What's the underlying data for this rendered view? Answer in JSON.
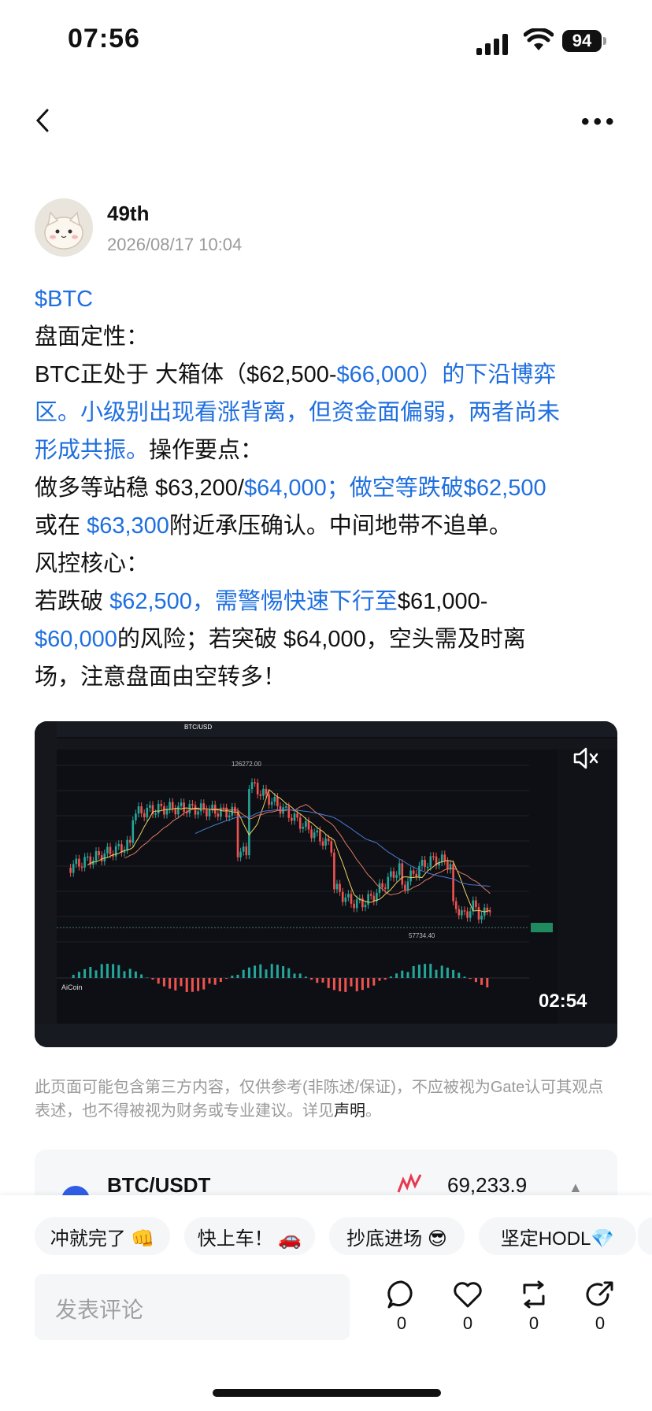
{
  "status_bar": {
    "time": "07:56",
    "battery": "94"
  },
  "author": {
    "name": "49th",
    "timestamp": "2026/08/17 10:04"
  },
  "post": {
    "lines": [
      [
        {
          "t": "$BTC",
          "c": "blue"
        }
      ],
      [
        {
          "t": "盘面定性：",
          "c": "black"
        }
      ],
      [
        {
          "t": "BTC正处于 大箱体（$62,500-",
          "c": "black"
        },
        {
          "t": "$66,000）的下沿博弈",
          "c": "blue"
        }
      ],
      [
        {
          "t": "区。小级别出现看涨背离，但资金面偏弱，两者尚未",
          "c": "blue"
        }
      ],
      [
        {
          "t": "形成共振。",
          "c": "blue"
        },
        {
          "t": "操作要点：",
          "c": "black"
        }
      ],
      [
        {
          "t": "做多等站稳 $63,200/",
          "c": "black"
        },
        {
          "t": "$64,000；做空等跌破$62,500",
          "c": "blue"
        }
      ],
      [
        {
          "t": "或在 ",
          "c": "black"
        },
        {
          "t": "$63,300",
          "c": "blue"
        },
        {
          "t": "附近承压确认。中间地带不追单。",
          "c": "black"
        }
      ],
      [
        {
          "t": "风控核心：",
          "c": "black"
        }
      ],
      [
        {
          "t": "若跌破 ",
          "c": "black"
        },
        {
          "t": "$62,500，需警惕快速下行至",
          "c": "blue"
        },
        {
          "t": "$61,000-",
          "c": "black"
        }
      ],
      [
        {
          "t": "$60,000",
          "c": "blue"
        },
        {
          "t": "的风险；若突破 $64,000，空头需及时离",
          "c": "black"
        }
      ],
      [
        {
          "t": "场，注意盘面由空转多！",
          "c": "black"
        }
      ]
    ]
  },
  "video": {
    "duration": "02:54",
    "watermark": "AiCoin",
    "high_label": "126272.00",
    "low_label": "57734.40",
    "pair_label": "BTC/USD"
  },
  "disclaimer": {
    "text": "此页面可能包含第三方内容，仅供参考(非陈述/保证)，不应被视为Gate认可其观点表述，也不得被视为财务或专业建议。详见",
    "link": "声明",
    "end": "。"
  },
  "ticker": {
    "pair": "BTC/USDT",
    "price": "69,233.9"
  },
  "quick_replies": [
    "冲就完了 👊",
    "快上车！ 🚗",
    "抄底进场 😎",
    "坚定HODL💎"
  ],
  "comment": {
    "placeholder": "发表评论"
  },
  "actions": [
    {
      "name": "comment",
      "count": "0"
    },
    {
      "name": "like",
      "count": "0"
    },
    {
      "name": "repost",
      "count": "0"
    },
    {
      "name": "share",
      "count": "0"
    }
  ],
  "colors": {
    "accent_blue": "#1f6fe0",
    "candle_up": "#26a69a",
    "candle_down": "#ef5350"
  }
}
